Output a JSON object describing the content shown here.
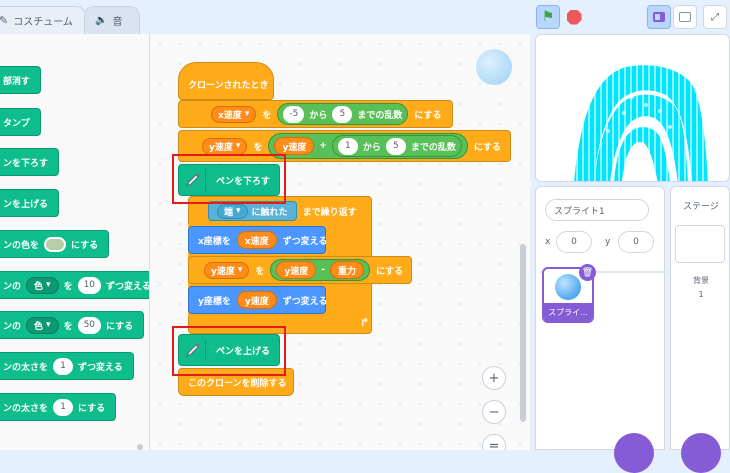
{
  "tabs": [
    {
      "label": "コスチューム",
      "icon": "brush-icon"
    },
    {
      "label": "音",
      "icon": "speaker-icon"
    }
  ],
  "palette": {
    "blocks": [
      {
        "text": "部消す"
      },
      {
        "text": "タンプ"
      },
      {
        "text": "ンを下ろす"
      },
      {
        "text": "ンを上げる"
      },
      {
        "pre": "ンの色を",
        "post": "にする"
      },
      {
        "pre": "ンの",
        "dd": "色",
        "mid": "を",
        "val": "10",
        "post": "ずつ変える"
      },
      {
        "pre": "ンの",
        "dd": "色",
        "mid": "を",
        "val": "50",
        "post": "にする"
      },
      {
        "pre": "ンの太さを",
        "val": "1",
        "post": "ずつ変える"
      },
      {
        "pre": "ンの太さを",
        "val": "1",
        "post": "にする"
      }
    ]
  },
  "script": {
    "hat": "クローンされたとき",
    "set_x": {
      "var": "x速度",
      "wo": "を",
      "from": "-5",
      "kara": "から",
      "to": "5",
      "rand": "までの乱数",
      "suffix": "にする"
    },
    "set_y": {
      "var": "y速度",
      "wo": "を",
      "op_var": "y速度",
      "plus": "+",
      "from": "1",
      "kara": "から",
      "to": "5",
      "rand": "までの乱数",
      "suffix": "にする"
    },
    "pen_down": "ペンを下ろす",
    "repeat_until": {
      "sensor_dd": "端",
      "sensor_text": "に触れた",
      "suffix": "まで繰り返す"
    },
    "change_x": {
      "prefix": "x座標を",
      "var": "x速度",
      "suffix": "ずつ変える"
    },
    "set_y2": {
      "var": "y速度",
      "wo": "を",
      "op_var": "y速度",
      "minus": "-",
      "op_var2": "重力",
      "suffix": "にする"
    },
    "change_y": {
      "prefix": "y座標を",
      "var": "y速度",
      "suffix": "ずつ変える"
    },
    "pen_up": "ペンを上げる",
    "delete_clone": "このクローンを削除する"
  },
  "zoom": {
    "in": "+",
    "out": "−",
    "reset": "="
  },
  "sprite_panel": {
    "name": "スプライト1",
    "x_label": "x",
    "x_value": "0",
    "y_label": "y",
    "y_value": "0",
    "thumb_label": "スプライ..."
  },
  "stage_panel": {
    "title": "ステージ",
    "backdrop_label": "背景",
    "backdrop_count": "1"
  },
  "colors": {
    "pen": "#0fbd8c",
    "control": "#ffab19",
    "motion": "#4c97ff",
    "variable": "#ff8c1a",
    "operator": "#59c059",
    "sensing": "#5cb1d6",
    "stage_art": "#00e5ff",
    "highlight": "#e41b1b"
  }
}
